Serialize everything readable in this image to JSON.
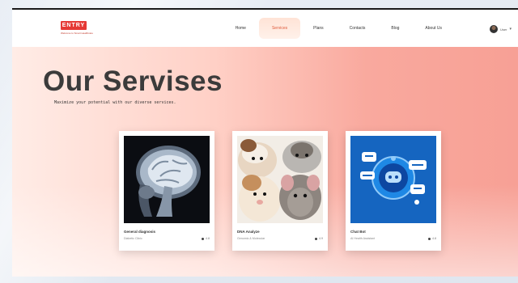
{
  "brand": {
    "logo_text": "ENTRY",
    "tagline": "Welcome to Smart Healthcare"
  },
  "nav": {
    "items": [
      {
        "label": "Home"
      },
      {
        "label": "Services",
        "active": true
      },
      {
        "label": "Plans"
      },
      {
        "label": "Contacts"
      },
      {
        "label": "Blog"
      },
      {
        "label": "About Us"
      }
    ]
  },
  "user": {
    "name": "User"
  },
  "hero": {
    "title": "Our Servises",
    "subtitle": "Maximize your potential with our diverse services."
  },
  "cards": [
    {
      "title": "General diagnosis",
      "subtitle": "Diabetic Clinic",
      "meta": "4.8",
      "image": "mri-brain-scan"
    },
    {
      "title": "DNA Analyze",
      "subtitle": "Genomic & Molecular",
      "meta": "4.9",
      "image": "hamster-and-rats"
    },
    {
      "title": "Chat Bot",
      "subtitle": "AI Health Assistant",
      "meta": "4.8",
      "image": "chatbot-robot"
    }
  ],
  "colors": {
    "accent": "#e53935",
    "hero_start": "#ffece6",
    "hero_end": "#f7a095"
  }
}
